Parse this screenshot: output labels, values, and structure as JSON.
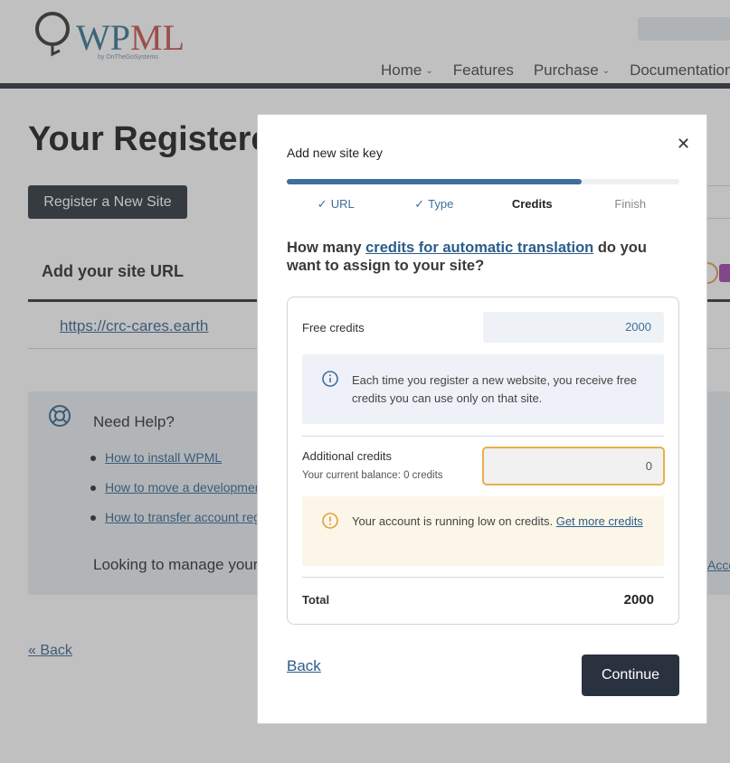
{
  "header": {
    "logo_text_wp": "WP",
    "logo_text_ml": "ML",
    "logo_by": "by OnTheGoSystems",
    "nav": [
      {
        "label": "Home",
        "has_dropdown": true
      },
      {
        "label": "Features",
        "has_dropdown": false
      },
      {
        "label": "Purchase",
        "has_dropdown": true
      },
      {
        "label": "Documentation",
        "has_dropdown": false
      }
    ]
  },
  "page": {
    "title": "Your Registered Sites",
    "register_button": "Register a New Site",
    "table_header": "Add your site URL",
    "site_url": "https://crc-cares.earth",
    "help": {
      "title": "Need Help?",
      "links": [
        "How to install WPML",
        "How to move a development site",
        "How to transfer account registration"
      ],
      "looking_text": "Looking to manage your account?",
      "account_link": "Account"
    },
    "back_link": "« Back"
  },
  "modal": {
    "title": "Add new site key",
    "close_icon": "close-icon",
    "progress": 0.75,
    "steps": [
      {
        "label": "URL",
        "state": "done"
      },
      {
        "label": "Type",
        "state": "done"
      },
      {
        "label": "Credits",
        "state": "active"
      },
      {
        "label": "Finish",
        "state": "pending"
      }
    ],
    "question_prefix": "How many ",
    "question_link": "credits for automatic translation",
    "question_suffix": " do you want to assign to your site?",
    "free_credits_label": "Free credits",
    "free_credits_value": "2000",
    "info_text": "Each time you register a new website, you receive free credits you can use only on that site.",
    "additional_label": "Additional credits",
    "additional_balance": "Your current balance: 0 credits",
    "additional_value": "0",
    "warning_text": "Your account is running low on credits. ",
    "warning_link": "Get more credits",
    "total_label": "Total",
    "total_value": "2000",
    "back_label": "Back",
    "continue_label": "Continue"
  },
  "colors": {
    "accent": "#3e6e9c",
    "primary_dark": "#2a3240",
    "warning_border": "#e7b04a",
    "link": "#2b5c8a"
  }
}
